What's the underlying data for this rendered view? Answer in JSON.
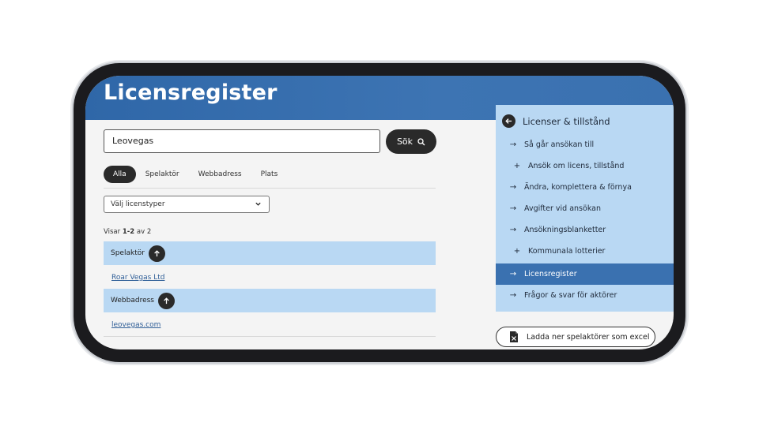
{
  "page": {
    "title": "Licensregister"
  },
  "search": {
    "value": "Leovegas",
    "button_label": "Sök"
  },
  "tabs": [
    {
      "label": "Alla",
      "active": true
    },
    {
      "label": "Spelaktör",
      "active": false
    },
    {
      "label": "Webbadress",
      "active": false
    },
    {
      "label": "Plats",
      "active": false
    }
  ],
  "filter": {
    "selected": "Välj licenstyper"
  },
  "results": {
    "count_prefix": "Visar ",
    "count_range": "1-2",
    "count_suffix": " av 2",
    "groups": [
      {
        "heading": "Spelaktör",
        "link": "Roar Vegas Ltd"
      },
      {
        "heading": "Webbadress",
        "link": "leovegas.com"
      }
    ]
  },
  "sidenav": {
    "heading": "Licenser & tillstånd",
    "items": [
      {
        "label": "Så går ansökan till",
        "icon": "arrow-right-icon",
        "active": false
      },
      {
        "label": "Ansök om licens, tillstånd",
        "icon": "plus-icon",
        "active": false
      },
      {
        "label": "Ändra, komplettera & förnya",
        "icon": "arrow-right-icon",
        "active": false
      },
      {
        "label": "Avgifter vid ansökan",
        "icon": "arrow-right-icon",
        "active": false
      },
      {
        "label": "Ansökningsblanketter",
        "icon": "arrow-right-icon",
        "active": false
      },
      {
        "label": "Kommunala lotterier",
        "icon": "plus-icon",
        "active": false
      },
      {
        "label": "Licensregister",
        "icon": "arrow-right-icon",
        "active": true
      },
      {
        "label": "Frågor & svar för aktörer",
        "icon": "arrow-right-icon",
        "active": false
      }
    ]
  },
  "download": {
    "label": "Ladda ner spelaktörer som excel"
  },
  "colors": {
    "brand_blue": "#2f67a8",
    "light_blue": "#b9d8f3",
    "active_blue": "#3a71b0",
    "dark": "#2a2a2a"
  }
}
